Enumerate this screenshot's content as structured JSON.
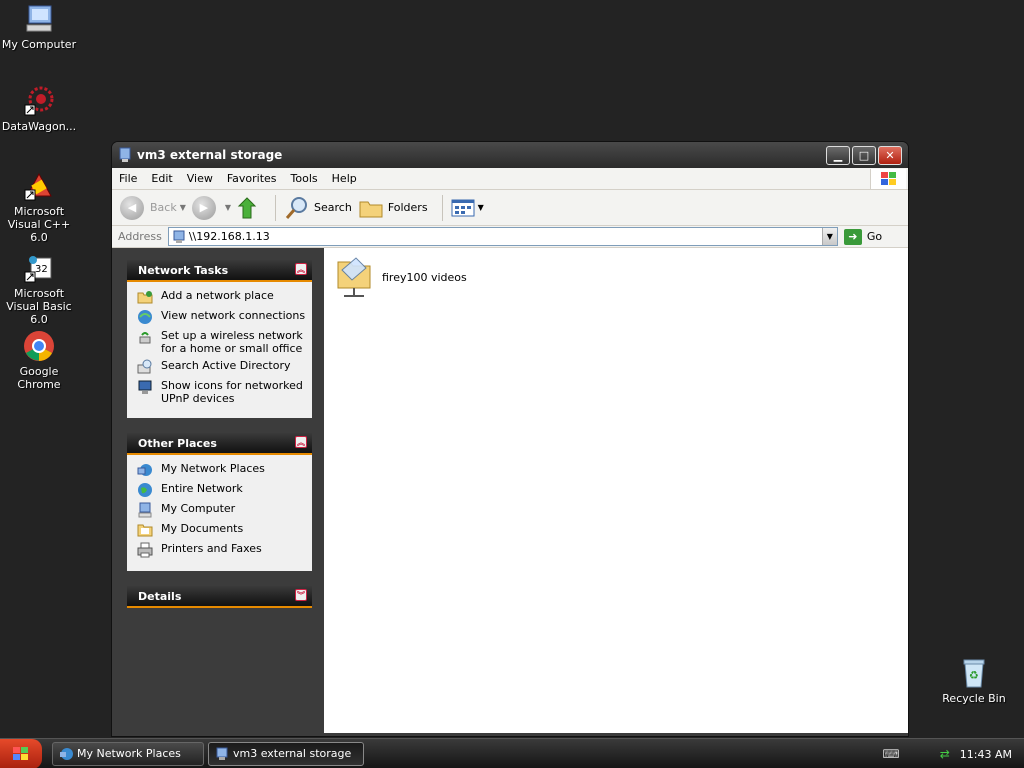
{
  "desktop": {
    "icons": [
      {
        "label": "My Computer",
        "icon": "my-computer-icon"
      },
      {
        "label": "DataWagon...",
        "icon": "datawagon-icon"
      },
      {
        "label": "Microsoft Visual C++ 6.0",
        "icon": "visual-cpp-icon"
      },
      {
        "label": "Microsoft Visual Basic 6.0",
        "icon": "visual-basic-icon"
      },
      {
        "label": "Google Chrome",
        "icon": "chrome-icon"
      },
      {
        "label": "Recycle Bin",
        "icon": "recycle-bin-icon"
      }
    ]
  },
  "window": {
    "title": "vm3 external storage",
    "menu": [
      "File",
      "Edit",
      "View",
      "Favorites",
      "Tools",
      "Help"
    ],
    "toolbar": {
      "back": "Back",
      "search": "Search",
      "folders": "Folders"
    },
    "address": {
      "label": "Address",
      "value": "\\\\192.168.1.13",
      "go": "Go"
    },
    "task_pane": {
      "network_tasks": {
        "title": "Network Tasks",
        "items": [
          "Add a network place",
          "View network connections",
          "Set up a wireless network for a home or small office",
          "Search Active Directory",
          "Show icons for networked UPnP devices"
        ]
      },
      "other_places": {
        "title": "Other Places",
        "items": [
          "My Network Places",
          "Entire Network",
          "My Computer",
          "My Documents",
          "Printers and Faxes"
        ]
      },
      "details": {
        "title": "Details"
      }
    },
    "files": [
      {
        "name": "firey100 videos",
        "icon": "shared-folder-icon"
      }
    ]
  },
  "taskbar": {
    "tasks": [
      "My Network Places",
      "vm3 external storage"
    ],
    "clock": "11:43 AM"
  },
  "colors": {
    "desktop_bg": "#232323",
    "accent": "#e68a00",
    "window_frame": "#3c3c3c"
  }
}
